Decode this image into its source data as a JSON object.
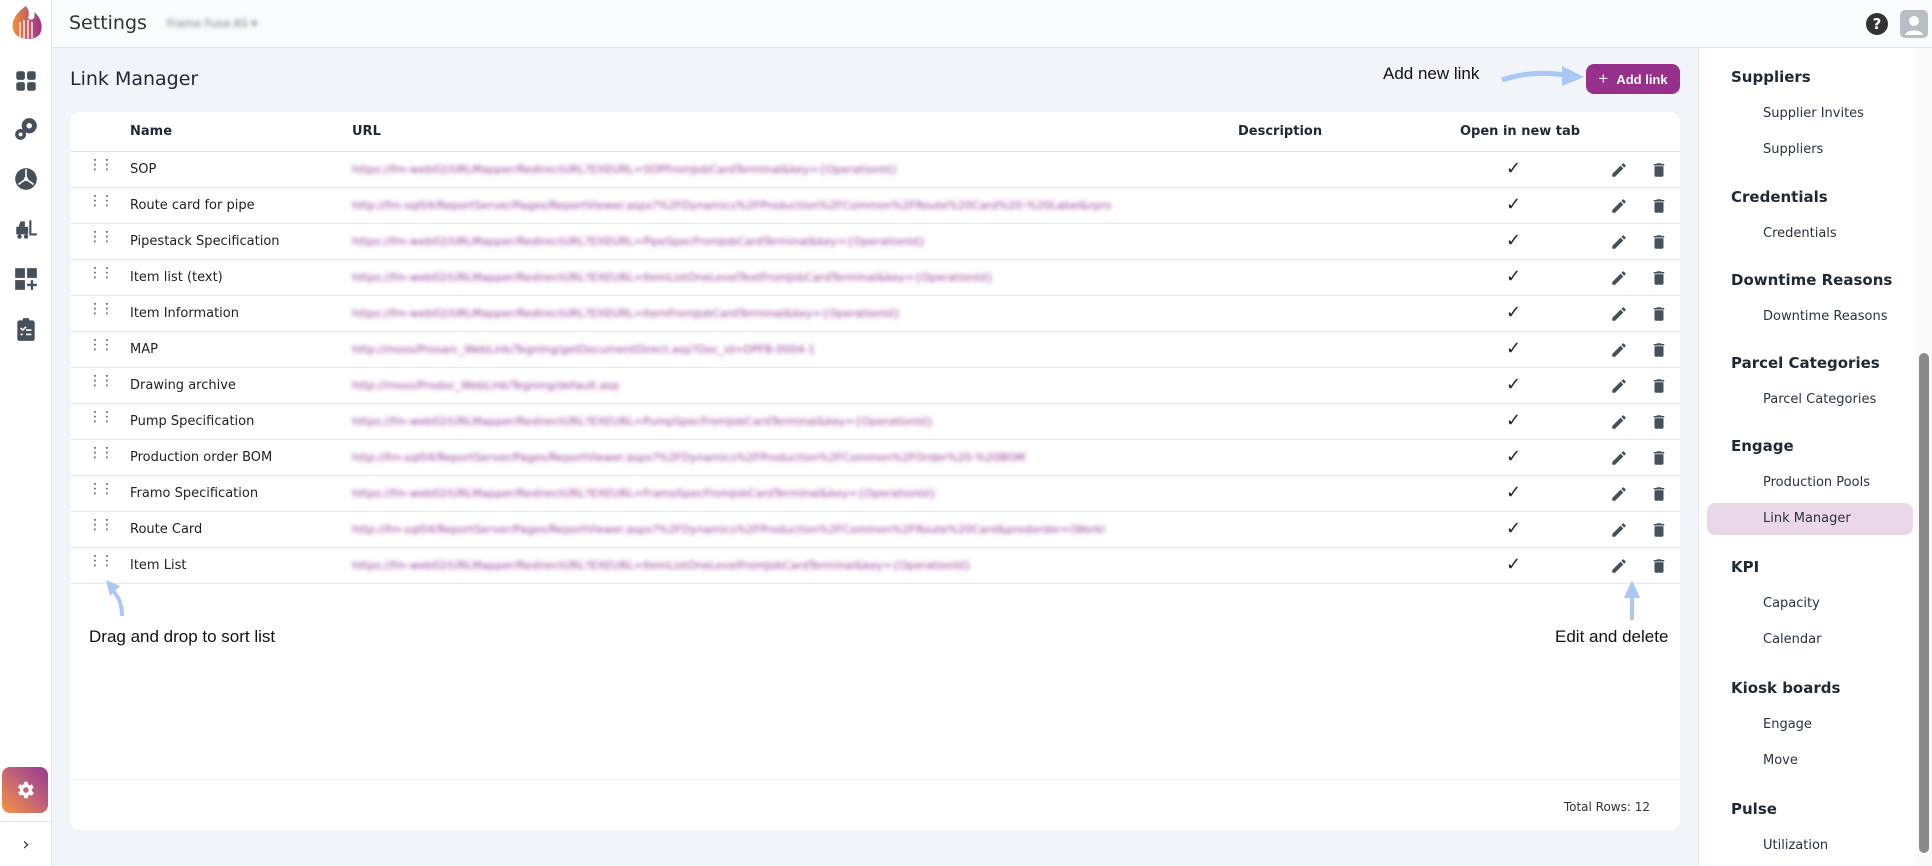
{
  "header": {
    "title": "Settings",
    "org": "Framo Fusa AS",
    "help_icon": "help-circle-icon",
    "avatar_icon": "user-avatar-icon"
  },
  "rail": {
    "icons": [
      "dashboard-icon",
      "gears-icon",
      "network-icon",
      "forklift-icon",
      "add-widget-icon",
      "clipboard-check-icon"
    ],
    "active": "settings-icon",
    "expand_icon": "chevron-right-icon"
  },
  "page": {
    "title": "Link Manager",
    "add_button": "Add link",
    "total": "Total Rows: 12"
  },
  "annotations": {
    "add": "Add new link",
    "drag": "Drag and drop to sort list",
    "edit": "Edit and delete"
  },
  "table": {
    "columns": [
      "Name",
      "URL",
      "Description",
      "Open in new tab"
    ],
    "rows": [
      {
        "name": "SOP",
        "url": "https://fm-web02/URLMapper/RedirectURL?EXEURL=SOPFromJobCardTerminal&key={OperationId}",
        "new_tab": true
      },
      {
        "name": "Route card for pipe",
        "url": "http://fm-sql04/ReportServer/Pages/ReportViewer.aspx?%2FDynamics%2FProduction%2FCommon%2FRoute%20Card%20-%20Label&rpro",
        "new_tab": true
      },
      {
        "name": "Pipestack Specification",
        "url": "https://fm-web02/URLMapper/RedirectURL?EXEURL=PipeSpecFromJobCardTerminal&key={OperationId}",
        "new_tab": true
      },
      {
        "name": "Item list (text)",
        "url": "https://fm-web02/URLMapper/RedirectURL?EXEURL=ItemListOneLevelTextFromJobCardTerminal&key={OperationId}",
        "new_tab": true
      },
      {
        "name": "Item Information",
        "url": "https://fm-web02/URLMapper/RedirectURL?EXEURL=ItemFromJobCardTerminal&key={OperationId}",
        "new_tab": true
      },
      {
        "name": "MAP",
        "url": "http://moss/Prosarc_WebLink/Tegning/getDocumentDirect.asp?Doc_id=DPFB-0004-1",
        "new_tab": true
      },
      {
        "name": "Drawing archive",
        "url": "http://moss/Prodoc_WebLink/Tegning/default.asp",
        "new_tab": true
      },
      {
        "name": "Pump Specification",
        "url": "https://fm-web02/URLMapper/RedirectURL?EXEURL=PumpSpecFromJobCardTerminal&key={OperationId}",
        "new_tab": true
      },
      {
        "name": "Production order BOM",
        "url": "http://fm-sql04/ReportServer/Pages/ReportViewer.aspx?%2FDynamics%2FProduction%2FCommon%2FOrder%20-%20BOM",
        "new_tab": true
      },
      {
        "name": "Framo Specification",
        "url": "https://fm-web02/URLMapper/RedirectURL?EXEURL=FramoSpecFromJobCardTerminal&key={OperationId}",
        "new_tab": true
      },
      {
        "name": "Route Card",
        "url": "http://fm-sql04/ReportServer/Pages/ReportViewer.aspx?%2FDynamics%2FProduction%2FCommon%2FRoute%20Card&prodorder=(Worki",
        "new_tab": true
      },
      {
        "name": "Item List",
        "url": "https://fm-web02/URLMapper/RedirectURL?EXEURL=ItemListOneLevelFromJobCardTerminal&key={OperationId}",
        "new_tab": true
      }
    ]
  },
  "nav": [
    {
      "heading": "Suppliers",
      "items": [
        "Supplier Invites",
        "Suppliers"
      ]
    },
    {
      "heading": "Credentials",
      "items": [
        "Credentials"
      ]
    },
    {
      "heading": "Downtime Reasons",
      "items": [
        "Downtime Reasons"
      ]
    },
    {
      "heading": "Parcel Categories",
      "items": [
        "Parcel Categories"
      ]
    },
    {
      "heading": "Engage",
      "items": [
        "Production Pools",
        "Link Manager"
      ]
    },
    {
      "heading": "KPI",
      "items": [
        "Capacity",
        "Calendar"
      ]
    },
    {
      "heading": "Kiosk boards",
      "items": [
        "Engage",
        "Move"
      ]
    },
    {
      "heading": "Pulse",
      "items": [
        "Utilization"
      ]
    }
  ],
  "nav_selected": "Link Manager",
  "colors": {
    "accent": "#96308b",
    "selected_bg": "#ead7ea",
    "annotation_arrow": "#a9c8f5"
  }
}
